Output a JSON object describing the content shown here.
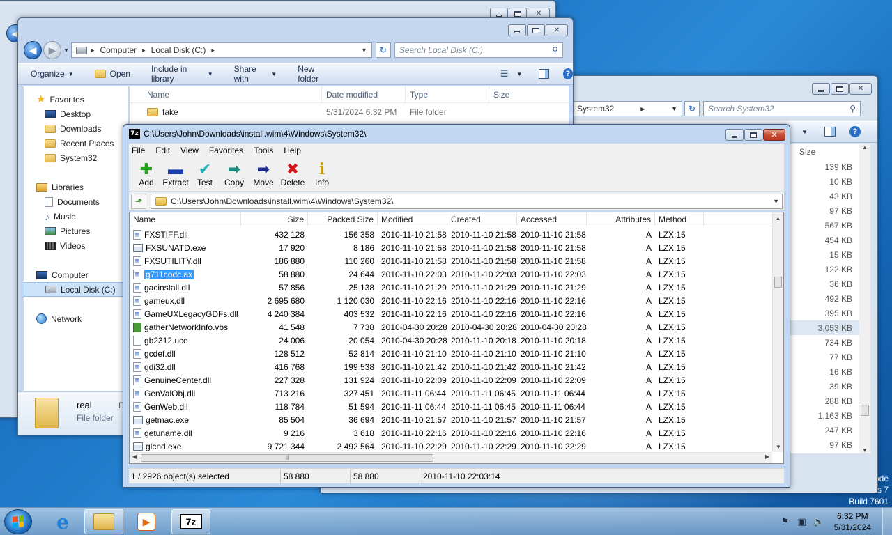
{
  "desktop": {
    "watermark_line1": "ode",
    "watermark_line2": "s 7",
    "build": "Build 7601"
  },
  "local_window": {
    "breadcrumb": [
      "Computer",
      "Local Disk (C:)"
    ],
    "search_placeholder": "Search Local Disk (C:)",
    "commands": [
      "Organize",
      "Open",
      "Include in library",
      "Share with",
      "New folder"
    ],
    "nav": {
      "favorites": "Favorites",
      "desktop": "Desktop",
      "downloads": "Downloads",
      "recent": "Recent Places",
      "system32": "System32",
      "libraries": "Libraries",
      "documents": "Documents",
      "music": "Music",
      "pictures": "Pictures",
      "videos": "Videos",
      "computer": "Computer",
      "local_disk": "Local Disk (C:)",
      "network": "Network"
    },
    "columns": [
      "Name",
      "Date modified",
      "Type",
      "Size"
    ],
    "row": {
      "name": "fake",
      "modified": "5/31/2024 6:32 PM",
      "type": "File folder"
    },
    "details": {
      "name": "real",
      "type": "File folder",
      "extra": "D"
    }
  },
  "right_window": {
    "breadcrumb": "System32",
    "search_placeholder": "Search System32",
    "size_header": "Size",
    "sizes": [
      "139 KB",
      "10 KB",
      "43 KB",
      "97 KB",
      "567 KB",
      "454 KB",
      "15 KB",
      "122 KB",
      "36 KB",
      "492 KB",
      "395 KB",
      "3,053 KB",
      "734 KB",
      "77 KB",
      "16 KB",
      "39 KB",
      "288 KB",
      "1,163 KB",
      "247 KB",
      "97 KB"
    ]
  },
  "sevenzip": {
    "title": "C:\\Users\\John\\Downloads\\install.wim\\4\\Windows\\System32\\",
    "logo": "7z",
    "menu": [
      "File",
      "Edit",
      "View",
      "Favorites",
      "Tools",
      "Help"
    ],
    "toolbar": {
      "add": "Add",
      "extract": "Extract",
      "test": "Test",
      "copy": "Copy",
      "move": "Move",
      "delete": "Delete",
      "info": "Info"
    },
    "path": "C:\\Users\\John\\Downloads\\install.wim\\4\\Windows\\System32\\",
    "columns": {
      "name": "Name",
      "size": "Size",
      "packed": "Packed Size",
      "modified": "Modified",
      "created": "Created",
      "accessed": "Accessed",
      "attributes": "Attributes",
      "method": "Method"
    },
    "files": [
      {
        "name": "FXSTIFF.dll",
        "icon": "dll",
        "size": "432 128",
        "packed": "156 358",
        "modified": "2010-11-10 21:58",
        "created": "2010-11-10 21:58",
        "accessed": "2010-11-10 21:58",
        "attr": "A",
        "method": "LZX:15"
      },
      {
        "name": "FXSUNATD.exe",
        "icon": "exe",
        "size": "17 920",
        "packed": "8 186",
        "modified": "2010-11-10 21:58",
        "created": "2010-11-10 21:58",
        "accessed": "2010-11-10 21:58",
        "attr": "A",
        "method": "LZX:15"
      },
      {
        "name": "FXSUTILITY.dll",
        "icon": "dll",
        "size": "186 880",
        "packed": "110 260",
        "modified": "2010-11-10 21:58",
        "created": "2010-11-10 21:58",
        "accessed": "2010-11-10 21:58",
        "attr": "A",
        "method": "LZX:15"
      },
      {
        "name": "g711codc.ax",
        "icon": "ax",
        "size": "58 880",
        "packed": "24 644",
        "modified": "2010-11-10 22:03",
        "created": "2010-11-10 22:03",
        "accessed": "2010-11-10 22:03",
        "attr": "A",
        "method": "LZX:15",
        "selected": true
      },
      {
        "name": "gacinstall.dll",
        "icon": "dll",
        "size": "57 856",
        "packed": "25 138",
        "modified": "2010-11-10 21:29",
        "created": "2010-11-10 21:29",
        "accessed": "2010-11-10 21:29",
        "attr": "A",
        "method": "LZX:15"
      },
      {
        "name": "gameux.dll",
        "icon": "dll",
        "size": "2 695 680",
        "packed": "1 120 030",
        "modified": "2010-11-10 22:16",
        "created": "2010-11-10 22:16",
        "accessed": "2010-11-10 22:16",
        "attr": "A",
        "method": "LZX:15"
      },
      {
        "name": "GameUXLegacyGDFs.dll",
        "icon": "dll",
        "size": "4 240 384",
        "packed": "403 532",
        "modified": "2010-11-10 22:16",
        "created": "2010-11-10 22:16",
        "accessed": "2010-11-10 22:16",
        "attr": "A",
        "method": "LZX:15"
      },
      {
        "name": "gatherNetworkInfo.vbs",
        "icon": "vbs",
        "size": "41 548",
        "packed": "7 738",
        "modified": "2010-04-30 20:28",
        "created": "2010-04-30 20:28",
        "accessed": "2010-04-30 20:28",
        "attr": "A",
        "method": "LZX:15"
      },
      {
        "name": "gb2312.uce",
        "icon": "plain",
        "size": "24 006",
        "packed": "20 054",
        "modified": "2010-04-30 20:28",
        "created": "2010-11-10 20:18",
        "accessed": "2010-11-10 20:18",
        "attr": "A",
        "method": "LZX:15"
      },
      {
        "name": "gcdef.dll",
        "icon": "dll",
        "size": "128 512",
        "packed": "52 814",
        "modified": "2010-11-10 21:10",
        "created": "2010-11-10 21:10",
        "accessed": "2010-11-10 21:10",
        "attr": "A",
        "method": "LZX:15"
      },
      {
        "name": "gdi32.dll",
        "icon": "dll",
        "size": "416 768",
        "packed": "199 538",
        "modified": "2010-11-10 21:42",
        "created": "2010-11-10 21:42",
        "accessed": "2010-11-10 21:42",
        "attr": "A",
        "method": "LZX:15"
      },
      {
        "name": "GenuineCenter.dll",
        "icon": "dll",
        "size": "227 328",
        "packed": "131 924",
        "modified": "2010-11-10 22:09",
        "created": "2010-11-10 22:09",
        "accessed": "2010-11-10 22:09",
        "attr": "A",
        "method": "LZX:15"
      },
      {
        "name": "GenValObj.dll",
        "icon": "dll",
        "size": "713 216",
        "packed": "327 451",
        "modified": "2010-11-11 06:44",
        "created": "2010-11-11 06:45",
        "accessed": "2010-11-11 06:44",
        "attr": "A",
        "method": "LZX:15"
      },
      {
        "name": "GenWeb.dll",
        "icon": "dll",
        "size": "118 784",
        "packed": "51 594",
        "modified": "2010-11-11 06:44",
        "created": "2010-11-11 06:45",
        "accessed": "2010-11-11 06:44",
        "attr": "A",
        "method": "LZX:15"
      },
      {
        "name": "getmac.exe",
        "icon": "exe",
        "size": "85 504",
        "packed": "36 694",
        "modified": "2010-11-10 21:57",
        "created": "2010-11-10 21:57",
        "accessed": "2010-11-10 21:57",
        "attr": "A",
        "method": "LZX:15"
      },
      {
        "name": "getuname.dll",
        "icon": "dll",
        "size": "9 216",
        "packed": "3 618",
        "modified": "2010-11-10 22:16",
        "created": "2010-11-10 22:16",
        "accessed": "2010-11-10 22:16",
        "attr": "A",
        "method": "LZX:15"
      },
      {
        "name": "glcnd.exe",
        "icon": "exe",
        "size": "9 721 344",
        "packed": "2 492 564",
        "modified": "2010-11-10 22:29",
        "created": "2010-11-10 22:29",
        "accessed": "2010-11-10 22:29",
        "attr": "A",
        "method": "LZX:15"
      }
    ],
    "status": {
      "selection": "1 / 2926 object(s) selected",
      "size": "58 880",
      "packed": "58 880",
      "modified": "2010-11-10 22:03:14"
    }
  },
  "taskbar": {
    "time": "6:32 PM",
    "date": "5/31/2024",
    "sevenzip_label": "7z"
  }
}
